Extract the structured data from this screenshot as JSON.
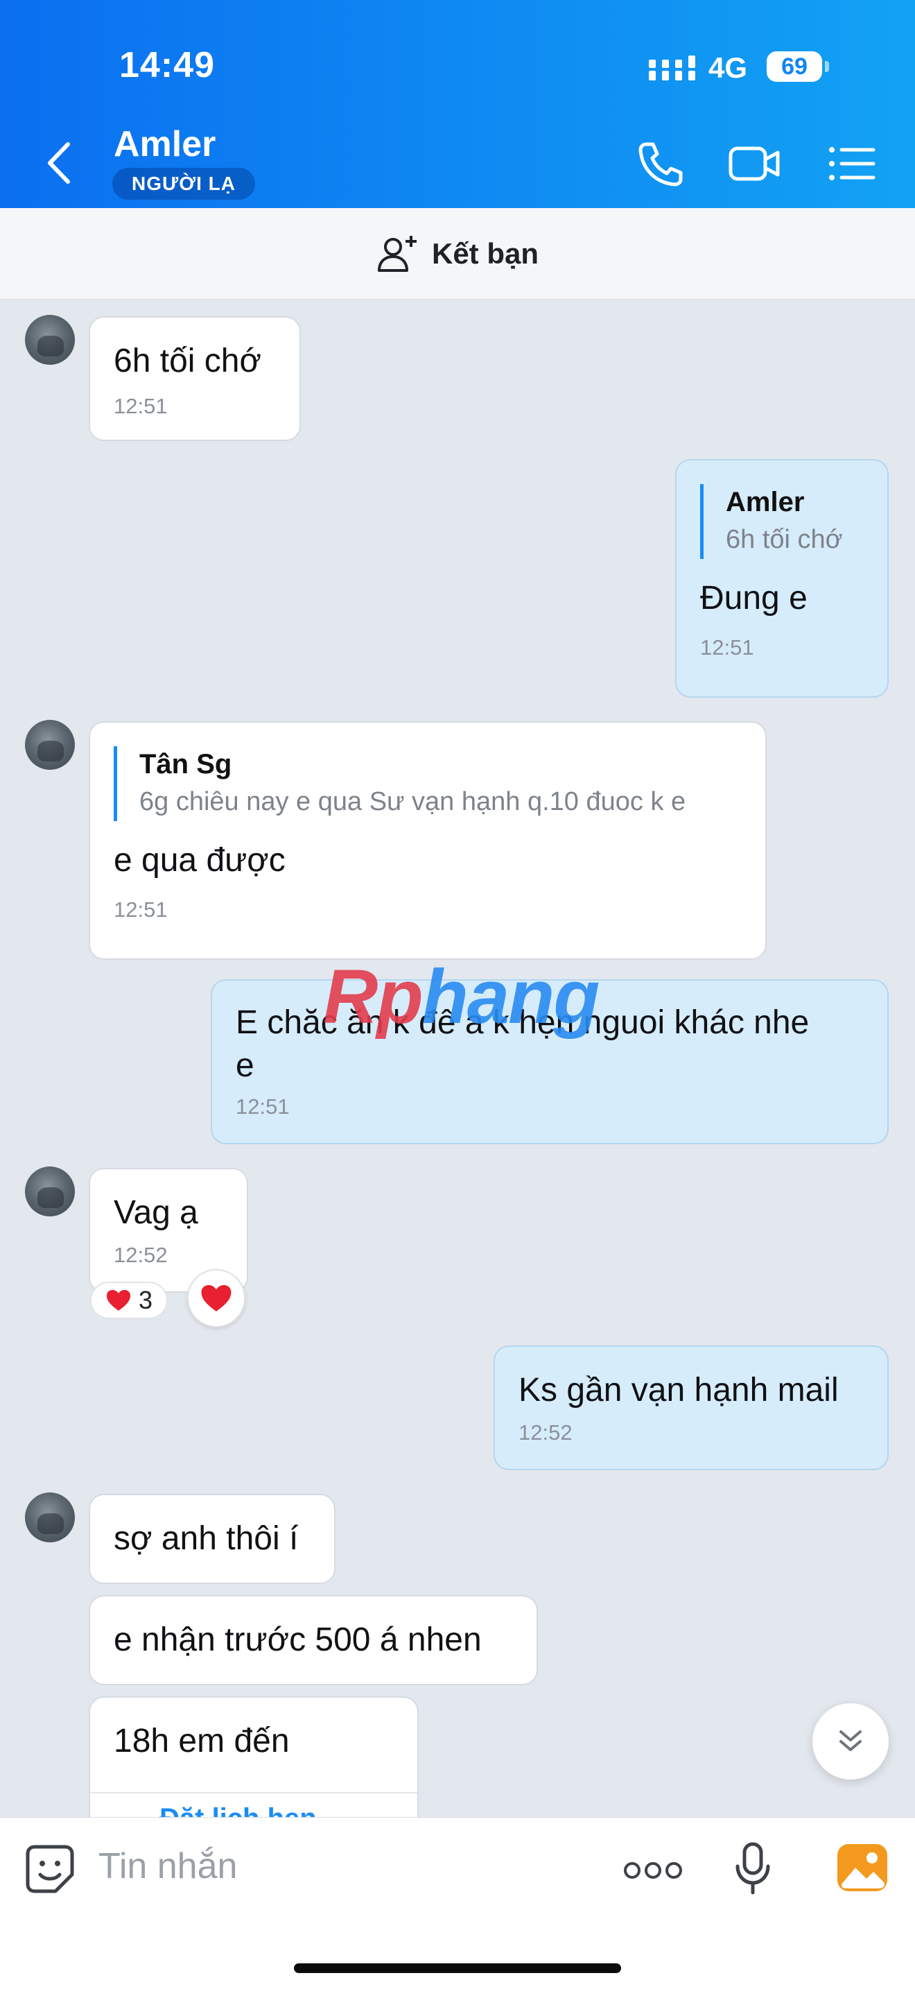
{
  "status": {
    "time": "14:49",
    "network": "4G",
    "battery": "69"
  },
  "header": {
    "title": "Amler",
    "badge": "NGƯỜI LẠ",
    "icons": [
      "back-icon",
      "phone-icon",
      "video-icon",
      "list-icon"
    ]
  },
  "add_friend": {
    "label": "Kết bạn",
    "icon": "add-user-icon"
  },
  "messages": [
    {
      "dir": "in",
      "text": "6h tối chớ",
      "time": "12:51"
    },
    {
      "dir": "out",
      "quote_name": "Amler",
      "quote_text": "6h tối chớ",
      "text": "Đung e",
      "time": "12:51"
    },
    {
      "dir": "in",
      "quote_name": "Tân Sg",
      "quote_text": "6g chiêu nay e qua Sư vạn hạnh q.10 đuoc k e",
      "text": "e qua được",
      "time": "12:51"
    },
    {
      "dir": "out",
      "text_line1": "E chăc ăn k đê a k hẹn nguoi khác nhe",
      "text_line2": "e",
      "time": "12:51"
    },
    {
      "dir": "in",
      "text": "Vag ạ",
      "time": "12:52",
      "reaction_count": "3"
    },
    {
      "dir": "out",
      "text": "Ks gần vạn hạnh mail",
      "time": "12:52"
    },
    {
      "dir": "in",
      "text": "sợ anh thôi í"
    },
    {
      "dir": "in",
      "text": "e nhận trước 500 á nhen"
    },
    {
      "dir": "in",
      "text": "18h em đến",
      "partial_text": "Đặt lịch hẹn"
    }
  ],
  "watermark": {
    "part1": "Rp",
    "part2": "hang"
  },
  "composer": {
    "placeholder": "Tin nhắn",
    "more_label": "ooo"
  },
  "colors": {
    "header_start": "#0b6ff0",
    "header_end": "#12a2f4",
    "out_bubble": "#d6ecfb",
    "accent": "#1a8cf5"
  }
}
